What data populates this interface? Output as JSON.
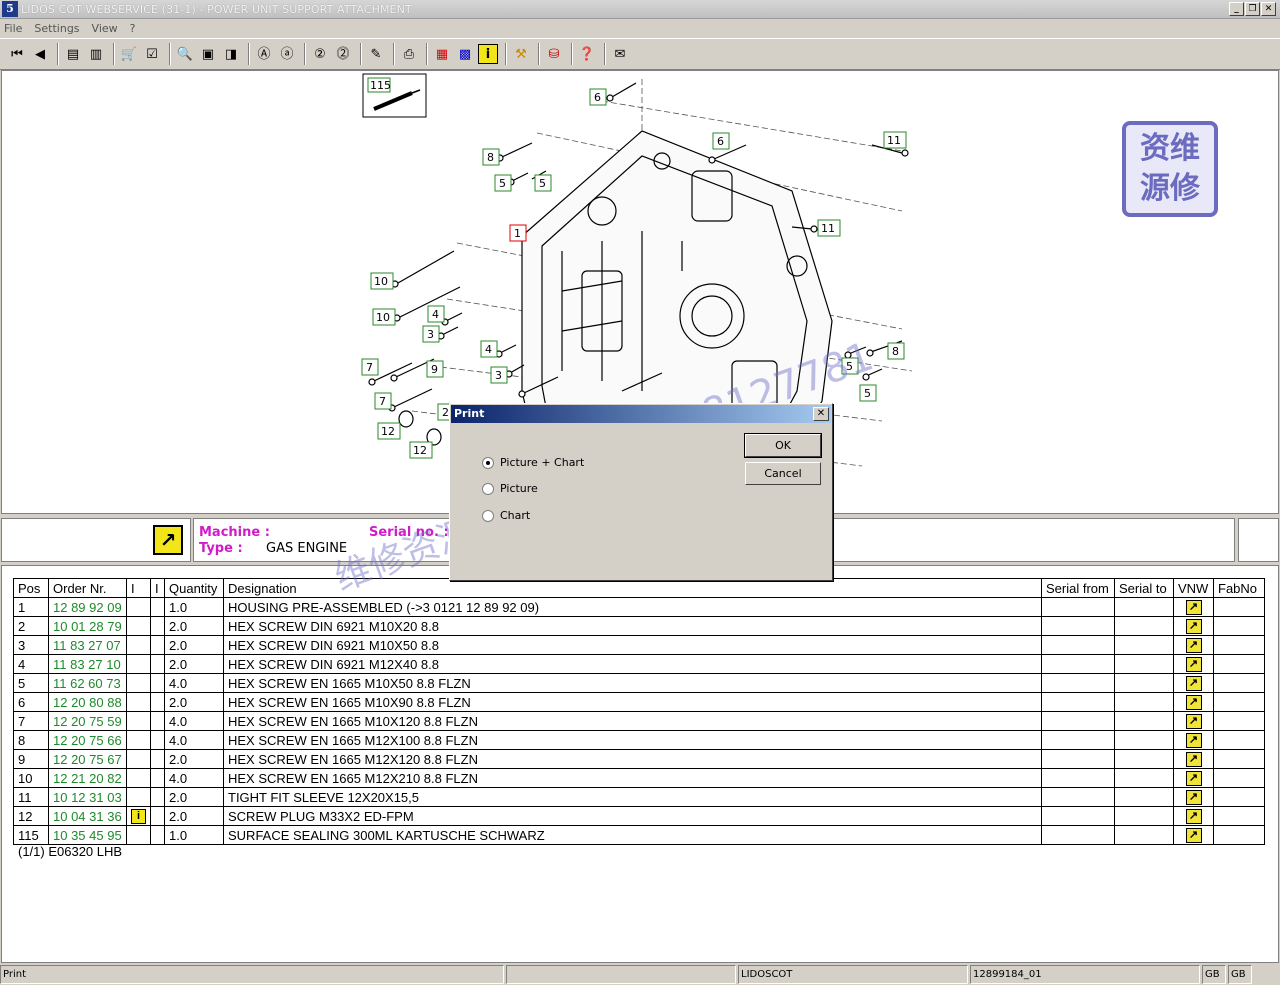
{
  "window": {
    "title": "LIDOS COT WEBSERVICE (31-1) - POWER UNIT SUPPORT ATTACHMENT",
    "logo": "5",
    "controls": [
      "_",
      "❐",
      "✕"
    ]
  },
  "menu": [
    "File",
    "Settings",
    "View",
    "?"
  ],
  "toolbar_icons": [
    "first-page-icon",
    "previous-icon",
    "back-list-icon",
    "forward-list-icon",
    "cart-icon",
    "checklist-icon",
    "zoom-in-icon",
    "page-icon",
    "page-fit-icon",
    "zoom-a-icon",
    "zoom-a-reset-icon",
    "zoom-2-icon",
    "zoom-2-reset-icon",
    "edit-icon",
    "print-icon",
    "grid-red-icon",
    "grid-blue-icon",
    "info-icon",
    "tools-icon",
    "basket-icon",
    "lidos-icon",
    "mail-icon"
  ],
  "drawing": {
    "callouts": [
      "115",
      "6",
      "8",
      "5",
      "5",
      "6",
      "11",
      "1",
      "11",
      "10",
      "10",
      "4",
      "3",
      "4",
      "3",
      "7",
      "9",
      "7",
      "2",
      "12",
      "12",
      "8",
      "5",
      "5"
    ],
    "watermark_logo": [
      "资维",
      "源修"
    ],
    "watermark_text_1": "18688127781",
    "watermark_text_2": "维修资源："
  },
  "info": {
    "machine_label": "Machine :",
    "machine_value": "",
    "serial_label": "Serial no. :",
    "serial_value": "",
    "type_label": "Type :",
    "type_value": "GAS ENGINE"
  },
  "table": {
    "headers": [
      "Pos",
      "Order Nr.",
      "I",
      "I",
      "Quantity",
      "Designation",
      "Serial from",
      "Serial to",
      "VNW",
      "FabNo"
    ],
    "rows": [
      {
        "pos": "1",
        "order": "12 89 92 09",
        "info": false,
        "qty": "1.0",
        "designation": "HOUSING PRE-ASSEMBLED (->3 0121 12 89 92 09)"
      },
      {
        "pos": "2",
        "order": "10 01 28 79",
        "info": false,
        "qty": "2.0",
        "designation": "HEX SCREW DIN 6921 M10X20 8.8"
      },
      {
        "pos": "3",
        "order": "11 83 27 07",
        "info": false,
        "qty": "2.0",
        "designation": "HEX SCREW DIN 6921 M10X50 8.8"
      },
      {
        "pos": "4",
        "order": "11 83 27 10",
        "info": false,
        "qty": "2.0",
        "designation": "HEX SCREW DIN 6921 M12X40 8.8"
      },
      {
        "pos": "5",
        "order": "11 62 60 73",
        "info": false,
        "qty": "4.0",
        "designation": "HEX SCREW EN 1665 M10X50 8.8 FLZN"
      },
      {
        "pos": "6",
        "order": "12 20 80 88",
        "info": false,
        "qty": "2.0",
        "designation": "HEX SCREW EN 1665 M10X90 8.8 FLZN"
      },
      {
        "pos": "7",
        "order": "12 20 75 59",
        "info": false,
        "qty": "4.0",
        "designation": "HEX SCREW EN 1665 M10X120 8.8 FLZN"
      },
      {
        "pos": "8",
        "order": "12 20 75 66",
        "info": false,
        "qty": "4.0",
        "designation": "HEX SCREW EN 1665 M12X100 8.8 FLZN"
      },
      {
        "pos": "9",
        "order": "12 20 75 67",
        "info": false,
        "qty": "2.0",
        "designation": "HEX SCREW EN 1665 M12X120 8.8 FLZN"
      },
      {
        "pos": "10",
        "order": "12 21 20 82",
        "info": false,
        "qty": "4.0",
        "designation": "HEX SCREW EN 1665 M12X210 8.8 FLZN"
      },
      {
        "pos": "11",
        "order": "10 12 31 03",
        "info": false,
        "qty": "2.0",
        "designation": "TIGHT FIT SLEEVE 12X20X15,5"
      },
      {
        "pos": "12",
        "order": "10 04 31 36",
        "info": true,
        "qty": "2.0",
        "designation": "SCREW PLUG M33X2 ED-FPM"
      },
      {
        "pos": "115",
        "order": "10 35 45 95",
        "info": false,
        "qty": "1.0",
        "designation": "SURFACE SEALING 300ML KARTUSCHE SCHWARZ"
      }
    ],
    "footnote": "(1/1) E06320 LHB"
  },
  "dialog": {
    "title": "Print",
    "options": [
      "Picture + Chart",
      "Picture",
      "Chart"
    ],
    "selected": 0,
    "ok_label": "OK",
    "cancel_label": "Cancel"
  },
  "status": {
    "left": "Print",
    "mid": "",
    "app": "LIDOSCOT",
    "doc": "12899184_01",
    "lang1": "GB",
    "lang2": "GB"
  }
}
